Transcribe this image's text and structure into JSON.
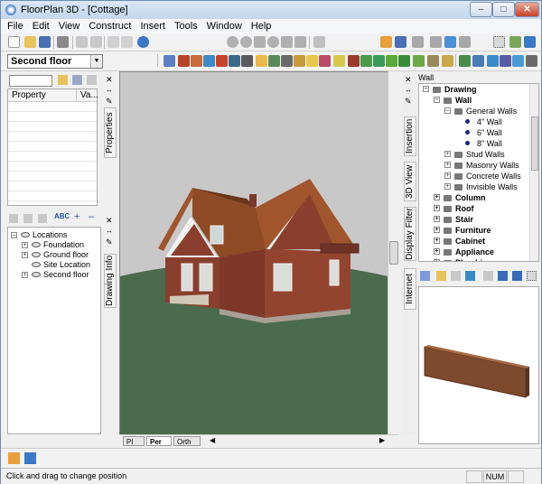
{
  "window": {
    "title": "FloorPlan 3D - [Cottage]",
    "minimize": "–",
    "maximize": "□",
    "close": "✕"
  },
  "menu": {
    "items": [
      "File",
      "Edit",
      "View",
      "Construct",
      "Insert",
      "Tools",
      "Window",
      "Help"
    ]
  },
  "floor_selector": {
    "value": "Second floor"
  },
  "properties": {
    "columns": [
      "Property",
      "Va..."
    ]
  },
  "left_tabs": {
    "properties": "Properties",
    "drawing_info": "Drawing Info"
  },
  "locations": {
    "toolbar": [
      "ABC",
      "+",
      "–"
    ],
    "root": "Locations",
    "children": [
      "Foundation",
      "Ground floor",
      "Site Location",
      "Second floor"
    ]
  },
  "view_tabs": [
    "Pl",
    "Per",
    "Orth"
  ],
  "right_tabs": {
    "insertion": "Insertion",
    "view3d": "3D View",
    "display_filter": "Display Filter",
    "internet": "Internet"
  },
  "library": {
    "breadcrumb": "Wall",
    "tree": [
      {
        "label": "Drawing",
        "level": 0,
        "bold": true,
        "expander": "–"
      },
      {
        "label": "Wall",
        "level": 1,
        "bold": true,
        "expander": "–"
      },
      {
        "label": "General Walls",
        "level": 2,
        "bold": false,
        "expander": "–"
      },
      {
        "label": "4\" Wall",
        "level": 3,
        "bold": false,
        "expander": ""
      },
      {
        "label": "6\" Wall",
        "level": 3,
        "bold": false,
        "expander": ""
      },
      {
        "label": "8\" Wall",
        "level": 3,
        "bold": false,
        "expander": ""
      },
      {
        "label": "Stud Walls",
        "level": 2,
        "bold": false,
        "expander": "+"
      },
      {
        "label": "Masonry Walls",
        "level": 2,
        "bold": false,
        "expander": "+"
      },
      {
        "label": "Concrete Walls",
        "level": 2,
        "bold": false,
        "expander": "+"
      },
      {
        "label": "Invisible Walls",
        "level": 2,
        "bold": false,
        "expander": "+"
      },
      {
        "label": "Column",
        "level": 1,
        "bold": true,
        "expander": "+"
      },
      {
        "label": "Roof",
        "level": 1,
        "bold": true,
        "expander": "+"
      },
      {
        "label": "Stair",
        "level": 1,
        "bold": true,
        "expander": "+"
      },
      {
        "label": "Furniture",
        "level": 1,
        "bold": true,
        "expander": "+"
      },
      {
        "label": "Cabinet",
        "level": 1,
        "bold": true,
        "expander": "+"
      },
      {
        "label": "Appliance",
        "level": 1,
        "bold": true,
        "expander": "+"
      },
      {
        "label": "Plumbing",
        "level": 1,
        "bold": true,
        "expander": "+"
      }
    ]
  },
  "status": {
    "message": "Click and drag to change position",
    "num": "NUM"
  },
  "colors": {
    "brick": "#8a3f2e",
    "roof": "#a0552c",
    "ground": "#4b6b4f",
    "sky": "#c9c8c9"
  }
}
